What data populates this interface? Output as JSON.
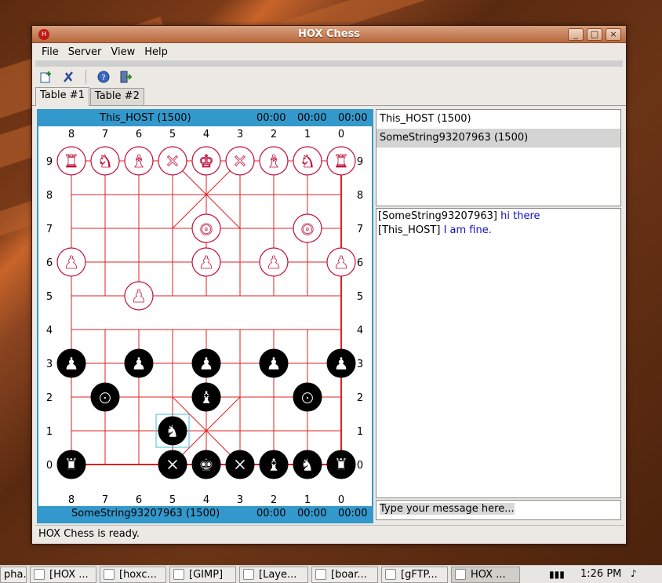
{
  "window": {
    "title": "HOX Chess"
  },
  "menu": [
    "File",
    "Server",
    "View",
    "Help"
  ],
  "toolbar": {
    "icons": [
      "new-table-icon",
      "close-table-icon",
      "help-icon",
      "exit-icon"
    ]
  },
  "tabs": [
    {
      "label": "Table #1",
      "active": true
    },
    {
      "label": "Table #2",
      "active": false
    }
  ],
  "board": {
    "top_player": {
      "name": "This_HOST (1500)",
      "times": [
        "00:00",
        "00:00",
        "00:00"
      ]
    },
    "bottom_player": {
      "name": "SomeString93207963 (1500)",
      "times": [
        "00:00",
        "00:00",
        "00:00"
      ]
    },
    "file_labels": [
      "8",
      "7",
      "6",
      "5",
      "4",
      "3",
      "2",
      "1",
      "0"
    ],
    "rank_labels": [
      "9",
      "8",
      "7",
      "6",
      "5",
      "4",
      "3",
      "2",
      "1",
      "0"
    ],
    "red_pieces": [
      {
        "type": "chariot",
        "file": 8,
        "rank": 9
      },
      {
        "type": "horse",
        "file": 7,
        "rank": 9
      },
      {
        "type": "elephant",
        "file": 6,
        "rank": 9
      },
      {
        "type": "advisor",
        "file": 5,
        "rank": 9
      },
      {
        "type": "king",
        "file": 4,
        "rank": 9
      },
      {
        "type": "advisor",
        "file": 3,
        "rank": 9
      },
      {
        "type": "elephant",
        "file": 2,
        "rank": 9
      },
      {
        "type": "horse",
        "file": 1,
        "rank": 9
      },
      {
        "type": "chariot",
        "file": 0,
        "rank": 9
      },
      {
        "type": "cannon",
        "file": 4,
        "rank": 7
      },
      {
        "type": "cannon",
        "file": 1,
        "rank": 7
      },
      {
        "type": "pawn",
        "file": 8,
        "rank": 6
      },
      {
        "type": "pawn",
        "file": 4,
        "rank": 6
      },
      {
        "type": "pawn",
        "file": 2,
        "rank": 6
      },
      {
        "type": "pawn",
        "file": 0,
        "rank": 6
      },
      {
        "type": "pawn",
        "file": 6,
        "rank": 5
      }
    ],
    "black_pieces": [
      {
        "type": "pawn",
        "file": 8,
        "rank": 3
      },
      {
        "type": "pawn",
        "file": 6,
        "rank": 3
      },
      {
        "type": "pawn",
        "file": 4,
        "rank": 3
      },
      {
        "type": "pawn",
        "file": 2,
        "rank": 3
      },
      {
        "type": "pawn",
        "file": 0,
        "rank": 3
      },
      {
        "type": "cannon",
        "file": 7,
        "rank": 2
      },
      {
        "type": "elephant",
        "file": 4,
        "rank": 2
      },
      {
        "type": "cannon",
        "file": 1,
        "rank": 2
      },
      {
        "type": "horse",
        "file": 5,
        "rank": 1
      },
      {
        "type": "chariot",
        "file": 8,
        "rank": 0
      },
      {
        "type": "advisor",
        "file": 5,
        "rank": 0
      },
      {
        "type": "king",
        "file": 4,
        "rank": 0
      },
      {
        "type": "advisor",
        "file": 3,
        "rank": 0
      },
      {
        "type": "elephant",
        "file": 2,
        "rank": 0
      },
      {
        "type": "horse",
        "file": 1,
        "rank": 0
      },
      {
        "type": "chariot",
        "file": 0,
        "rank": 0
      }
    ],
    "highlight": {
      "file": 5,
      "rank": 1
    }
  },
  "players": [
    {
      "name": "This_HOST (1500)",
      "selected": false
    },
    {
      "name": "SomeString93207963 (1500)",
      "selected": true
    }
  ],
  "chat": [
    {
      "sender": "[SomeString93207963]",
      "message": "hi there"
    },
    {
      "sender": "[This_HOST]",
      "message": "I am fine."
    }
  ],
  "chat_input": {
    "placeholder": "Type your message here..."
  },
  "status": "HOX Chess is ready.",
  "taskbar": {
    "tasks": [
      "pha...",
      "[HOX ...",
      "[hoxc...",
      "[GIMP]",
      "[Laye...",
      "[boar...",
      "[gFTP...",
      "HOX ..."
    ],
    "clock": "1:26 PM"
  },
  "colors": {
    "red": "#c0103a",
    "black": "#000000",
    "accent": "#3399cc",
    "grid": "#e02020"
  }
}
